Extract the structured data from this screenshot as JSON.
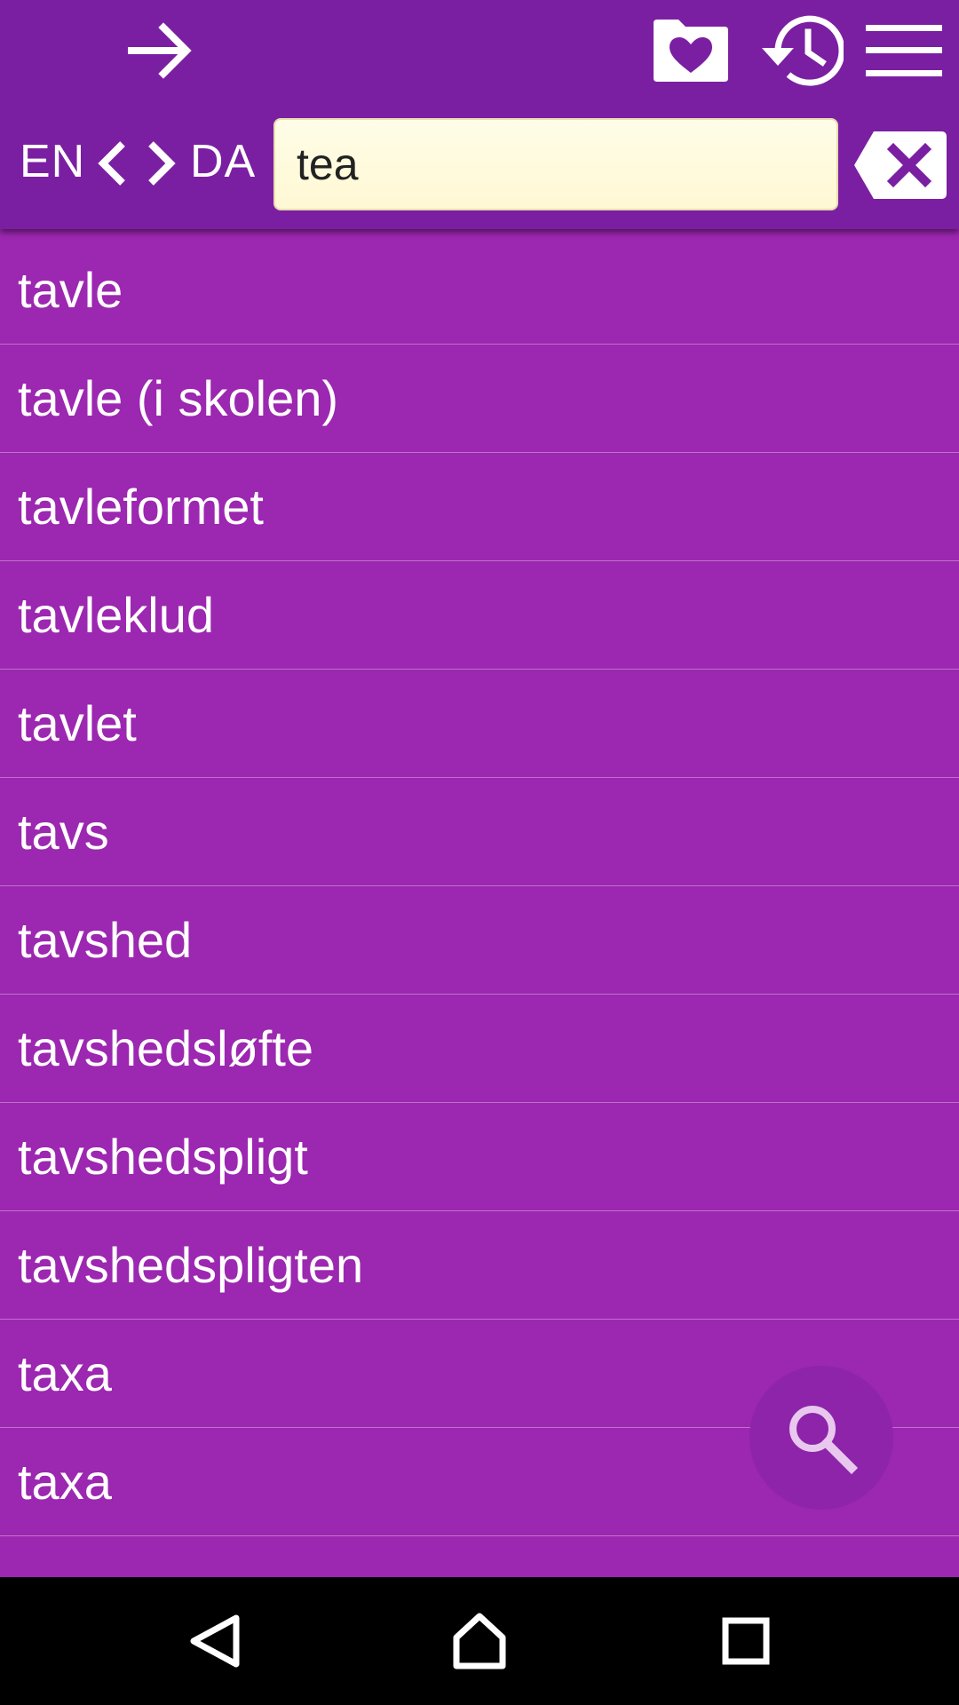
{
  "header": {
    "icons": {
      "back": "arrow-right-icon",
      "favorites": "folder-heart-icon",
      "history": "history-icon",
      "menu": "hamburger-menu-icon"
    },
    "language_from": "EN",
    "language_to": "DA",
    "search_value": "tea",
    "clear_icon": "backspace-clear-icon"
  },
  "results": [
    "tavle",
    "tavle (i skolen)",
    "tavleformet",
    "tavleklud",
    "tavlet",
    "tavs",
    "tavshed",
    "tavshedsløfte",
    "tavshedspligt",
    "tavshedspligten",
    "taxa",
    "taxa"
  ],
  "fab_icon": "search-icon",
  "navbar": {
    "back_icon": "nav-back-icon",
    "home_icon": "nav-home-icon",
    "recent_icon": "nav-recent-apps-icon"
  },
  "colors": {
    "toolbar": "#7b1fa2",
    "background": "#9c27b0",
    "fab": "#8e24aa",
    "search_field": "#fff8d4"
  }
}
